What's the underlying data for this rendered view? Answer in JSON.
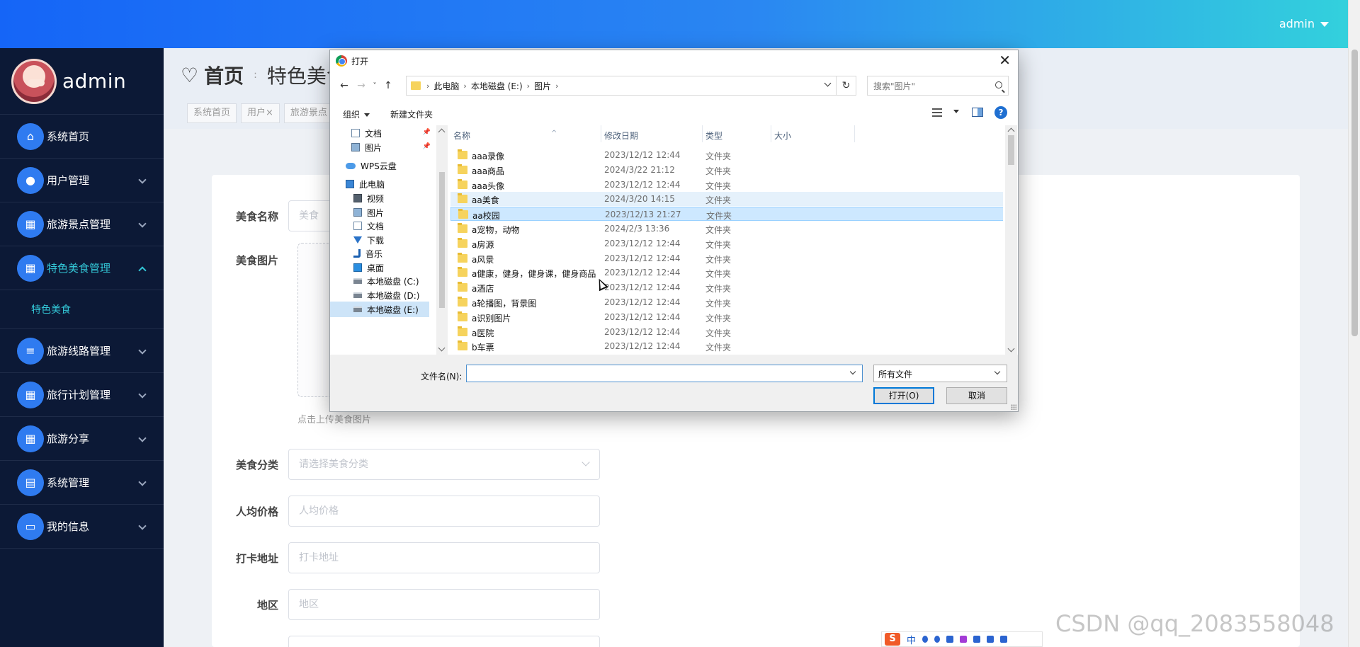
{
  "topbar": {
    "user": "admin"
  },
  "sidebar": {
    "profile_name": "admin",
    "items": [
      {
        "label": "系统首页",
        "icon": "home-icon",
        "has_children": false,
        "active": false
      },
      {
        "label": "用户管理",
        "icon": "lightbulb-icon",
        "has_children": true,
        "active": false
      },
      {
        "label": "旅游景点管理",
        "icon": "grid-icon",
        "has_children": true,
        "active": false
      },
      {
        "label": "特色美食管理",
        "icon": "grid-icon",
        "has_children": true,
        "active": true
      },
      {
        "label": "旅游线路管理",
        "icon": "list-icon",
        "has_children": true,
        "active": false
      },
      {
        "label": "旅行计划管理",
        "icon": "table-icon",
        "has_children": true,
        "active": false
      },
      {
        "label": "旅游分享",
        "icon": "grid-icon",
        "has_children": true,
        "active": false
      },
      {
        "label": "系统管理",
        "icon": "clipboard-icon",
        "has_children": true,
        "active": false
      },
      {
        "label": "我的信息",
        "icon": "card-icon",
        "has_children": true,
        "active": false
      }
    ],
    "submenu_label": "特色美食"
  },
  "breadcrumb": {
    "home": "首页",
    "separator": ":",
    "current": "特色美食"
  },
  "tags": [
    "系统首页",
    "用户×",
    "旅游景点"
  ],
  "form": {
    "name_label": "美食名称",
    "name_placeholder": "美食",
    "image_label": "美食图片",
    "upload_tip": "点击上传美食图片",
    "category_label": "美食分类",
    "category_placeholder": "请选择美食分类",
    "price_label": "人均价格",
    "price_placeholder": "人均价格",
    "address_label": "打卡地址",
    "address_placeholder": "打卡地址",
    "region_label": "地区",
    "region_placeholder": "地区"
  },
  "dialog": {
    "title": "打开",
    "path": [
      "此电脑",
      "本地磁盘 (E:)",
      "图片"
    ],
    "search_placeholder": "搜索\"图片\"",
    "organize": "组织",
    "new_folder": "新建文件夹",
    "tree": [
      {
        "label": "文档",
        "icon": "document-icon",
        "pinned": true
      },
      {
        "label": "图片",
        "icon": "picture-icon",
        "pinned": true
      },
      {
        "label": "WPS云盘",
        "icon": "cloud-icon",
        "pinned": false
      },
      {
        "label": "此电脑",
        "icon": "computer-icon",
        "pinned": false
      },
      {
        "label": "视频",
        "icon": "video-icon",
        "pinned": false
      },
      {
        "label": "图片",
        "icon": "picture-icon",
        "pinned": false
      },
      {
        "label": "文档",
        "icon": "document-icon",
        "pinned": false
      },
      {
        "label": "下载",
        "icon": "download-icon",
        "pinned": false
      },
      {
        "label": "音乐",
        "icon": "music-icon",
        "pinned": false
      },
      {
        "label": "桌面",
        "icon": "desktop-icon",
        "pinned": false
      },
      {
        "label": "本地磁盘 (C:)",
        "icon": "disk-icon",
        "pinned": false
      },
      {
        "label": "本地磁盘 (D:)",
        "icon": "disk-icon",
        "pinned": false
      },
      {
        "label": "本地磁盘 (E:)",
        "icon": "disk-icon",
        "pinned": false,
        "selected": true
      }
    ],
    "columns": [
      "名称",
      "修改日期",
      "类型",
      "大小"
    ],
    "files": [
      {
        "name": "aaa录像",
        "date": "2023/12/12 12:44",
        "type": "文件夹"
      },
      {
        "name": "aaa商品",
        "date": "2024/3/22 21:12",
        "type": "文件夹"
      },
      {
        "name": "aaa头像",
        "date": "2023/12/12 12:44",
        "type": "文件夹"
      },
      {
        "name": "aa美食",
        "date": "2024/3/20 14:15",
        "type": "文件夹",
        "state": "hover"
      },
      {
        "name": "aa校园",
        "date": "2023/12/13 21:27",
        "type": "文件夹",
        "state": "selected"
      },
      {
        "name": "a宠物，动物",
        "date": "2024/2/3 13:36",
        "type": "文件夹"
      },
      {
        "name": "a房源",
        "date": "2023/12/12 12:44",
        "type": "文件夹"
      },
      {
        "name": "a风景",
        "date": "2023/12/12 12:44",
        "type": "文件夹"
      },
      {
        "name": "a健康，健身，健身课，健身商品",
        "date": "2023/12/12 12:44",
        "type": "文件夹"
      },
      {
        "name": "a酒店",
        "date": "2023/12/12 12:44",
        "type": "文件夹"
      },
      {
        "name": "a轮播图，背景图",
        "date": "2023/12/12 12:44",
        "type": "文件夹"
      },
      {
        "name": "a识别图片",
        "date": "2023/12/12 12:44",
        "type": "文件夹"
      },
      {
        "name": "a医院",
        "date": "2023/12/12 12:44",
        "type": "文件夹"
      },
      {
        "name": "b车票",
        "date": "2023/12/12 12:44",
        "type": "文件夹"
      }
    ],
    "filename_label": "文件名(N):",
    "filename_value": "",
    "filetype": "所有文件",
    "open_button": "打开(O)",
    "cancel_button": "取消"
  },
  "ime": {
    "lang": "中"
  },
  "watermark": "CSDN @qq_2083558048"
}
